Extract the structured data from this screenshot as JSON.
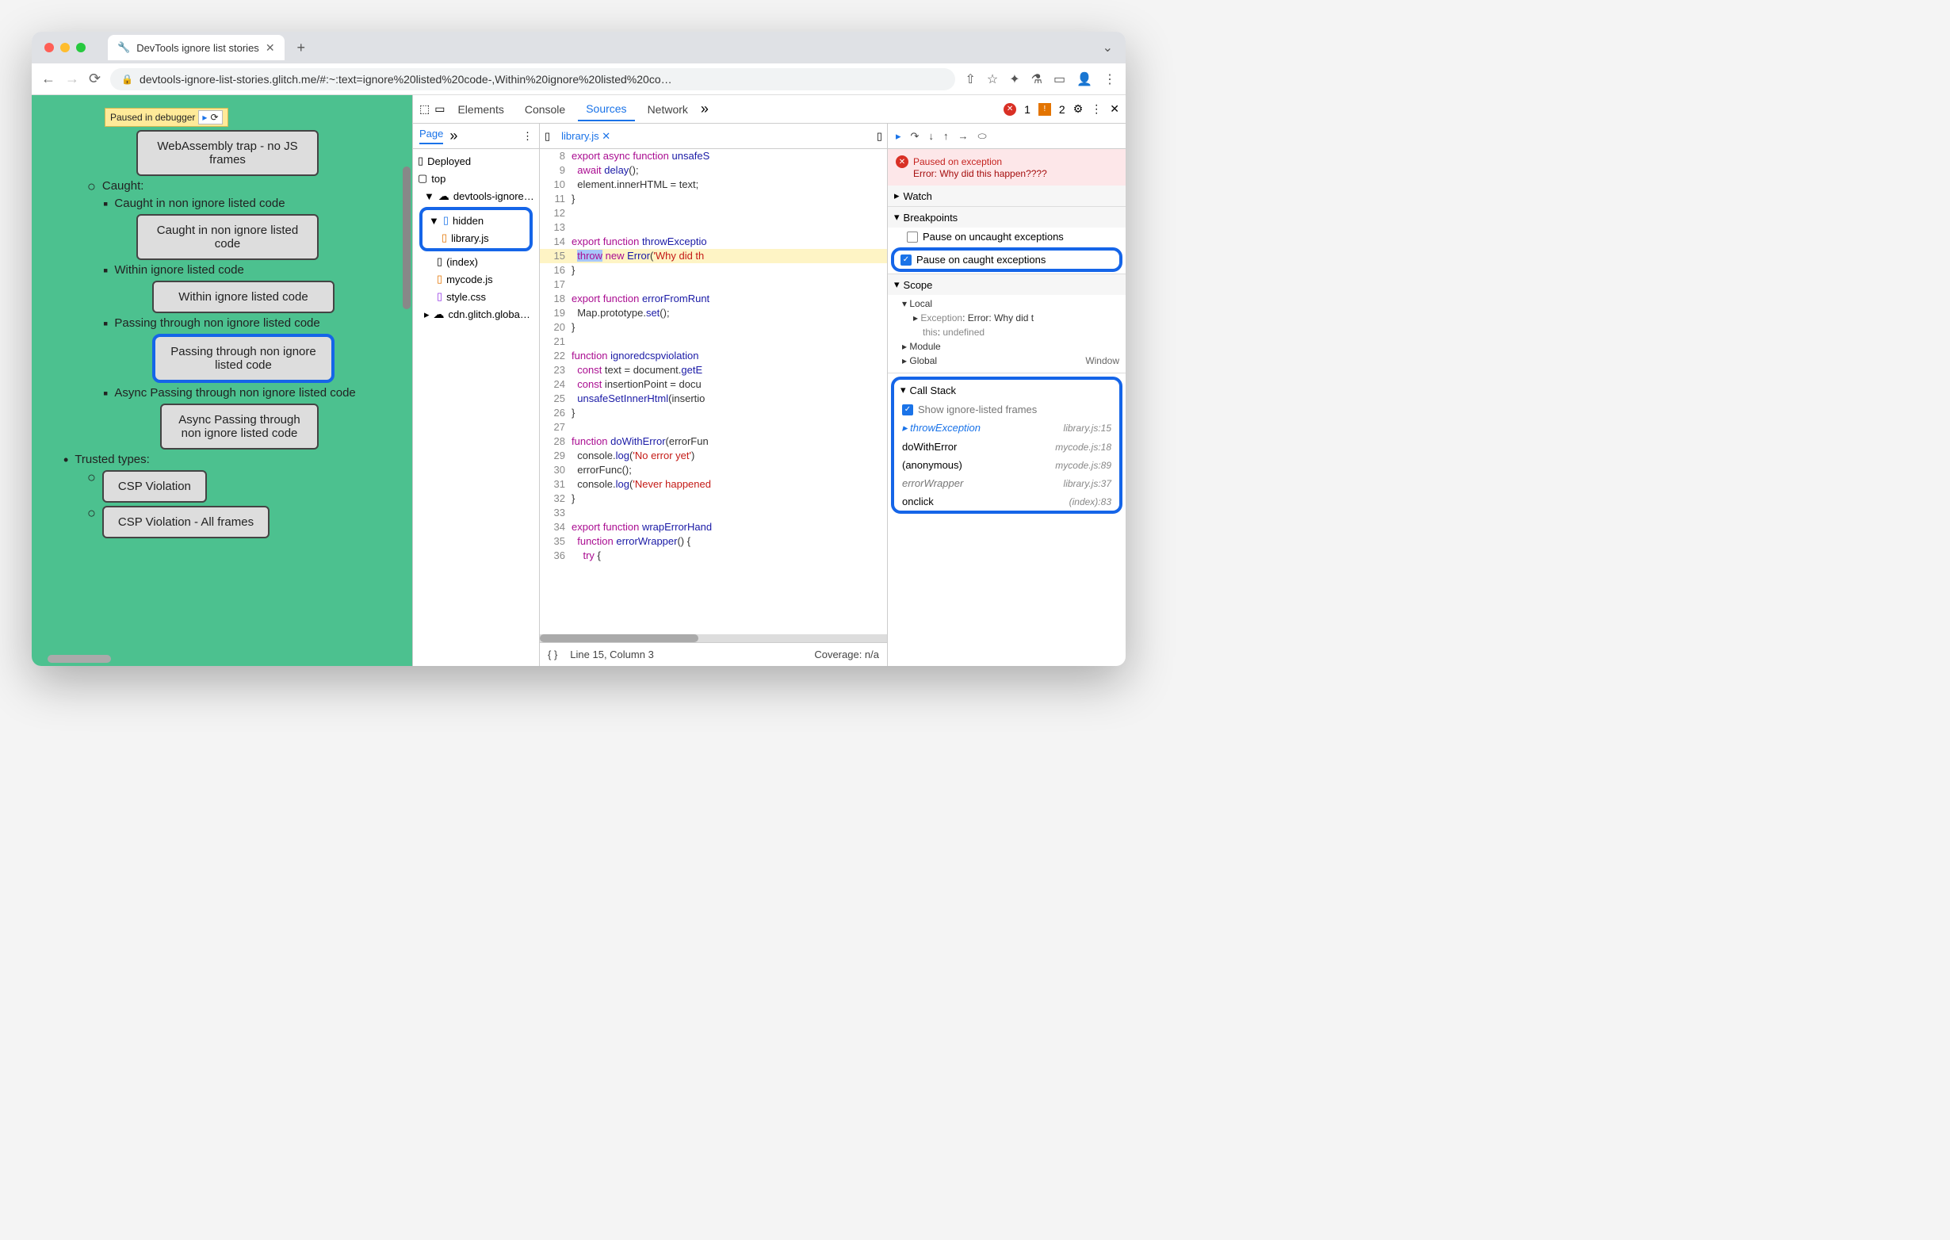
{
  "window": {
    "tab_title": "DevTools ignore list stories",
    "url": "devtools-ignore-list-stories.glitch.me/#:~:text=ignore%20listed%20code-,Within%20ignore%20listed%20co…"
  },
  "paused_chip": "Paused in debugger",
  "page_content": {
    "boxes": {
      "webassembly": "WebAssembly trap - no JS frames",
      "caught_non_ignore": "Caught in non ignore listed code",
      "within_ignore": "Within ignore listed code",
      "passing_non_ignore": "Passing through non ignore listed code",
      "async_passing": "Async Passing through non ignore listed code",
      "csp_violation": "CSP Violation",
      "csp_all": "CSP Violation - All frames"
    },
    "labels": {
      "caught": "Caught:",
      "caught_non_ignore": "Caught in non ignore listed code",
      "within_ignore": "Within ignore listed code",
      "passing_non_ignore": "Passing through non ignore listed code",
      "async_passing": "Async Passing through non ignore listed code",
      "trusted_types": "Trusted types:"
    }
  },
  "devtools": {
    "tabs": {
      "elements": "Elements",
      "console": "Console",
      "sources": "Sources",
      "network": "Network"
    },
    "errors": "1",
    "warnings": "2",
    "nav": {
      "page": "Page",
      "deployed": "Deployed",
      "top": "top",
      "domain": "devtools-ignore…",
      "hidden": "hidden",
      "library": "library.js",
      "index": "(index)",
      "mycode": "mycode.js",
      "style": "style.css",
      "cdn": "cdn.glitch.globa…"
    },
    "editor": {
      "tab": "library.js",
      "lines": [
        {
          "n": "8",
          "t": "export async function unsafeS"
        },
        {
          "n": "9",
          "t": "  await delay();"
        },
        {
          "n": "10",
          "t": "  element.innerHTML = text;"
        },
        {
          "n": "11",
          "t": "}"
        },
        {
          "n": "12",
          "t": ""
        },
        {
          "n": "13",
          "t": ""
        },
        {
          "n": "14",
          "t": "export function throwExceptio"
        },
        {
          "n": "15",
          "t": "  throw new Error('Why did th"
        },
        {
          "n": "16",
          "t": "}"
        },
        {
          "n": "17",
          "t": ""
        },
        {
          "n": "18",
          "t": "export function errorFromRunt"
        },
        {
          "n": "19",
          "t": "  Map.prototype.set();"
        },
        {
          "n": "20",
          "t": "}"
        },
        {
          "n": "21",
          "t": ""
        },
        {
          "n": "22",
          "t": "function ignoredcspviolation"
        },
        {
          "n": "23",
          "t": "  const text = document.getE"
        },
        {
          "n": "24",
          "t": "  const insertionPoint = docu"
        },
        {
          "n": "25",
          "t": "  unsafeSetInnerHtml(insertio"
        },
        {
          "n": "26",
          "t": "}"
        },
        {
          "n": "27",
          "t": ""
        },
        {
          "n": "28",
          "t": "function doWithError(errorFun"
        },
        {
          "n": "29",
          "t": "  console.log('No error yet')"
        },
        {
          "n": "30",
          "t": "  errorFunc();"
        },
        {
          "n": "31",
          "t": "  console.log('Never happened"
        },
        {
          "n": "32",
          "t": "}"
        },
        {
          "n": "33",
          "t": ""
        },
        {
          "n": "34",
          "t": "export function wrapErrorHand"
        },
        {
          "n": "35",
          "t": "  function errorWrapper() {"
        },
        {
          "n": "36",
          "t": "    try {"
        }
      ],
      "status_line": "Line 15, Column 3",
      "coverage": "Coverage: n/a"
    },
    "debugger": {
      "paused_title": "Paused on exception",
      "paused_detail": "Error: Why did this happen????",
      "watch": "Watch",
      "breakpoints": "Breakpoints",
      "bp_uncaught": "Pause on uncaught exceptions",
      "bp_caught": "Pause on caught exceptions",
      "scope": "Scope",
      "scope_local": "Local",
      "scope_exception": "Exception: Error: Why did t",
      "scope_this": "this: undefined",
      "scope_module": "Module",
      "scope_global": "Global",
      "scope_window": "Window",
      "callstack": "Call Stack",
      "cs_show": "Show ignore-listed frames",
      "frames": [
        {
          "name": "throwException",
          "loc": "library.js:15",
          "active": true,
          "italic": true
        },
        {
          "name": "doWithError",
          "loc": "mycode.js:18"
        },
        {
          "name": "(anonymous)",
          "loc": "mycode.js:89"
        },
        {
          "name": "errorWrapper",
          "loc": "library.js:37",
          "italic": true
        },
        {
          "name": "onclick",
          "loc": "(index):83"
        }
      ]
    }
  }
}
